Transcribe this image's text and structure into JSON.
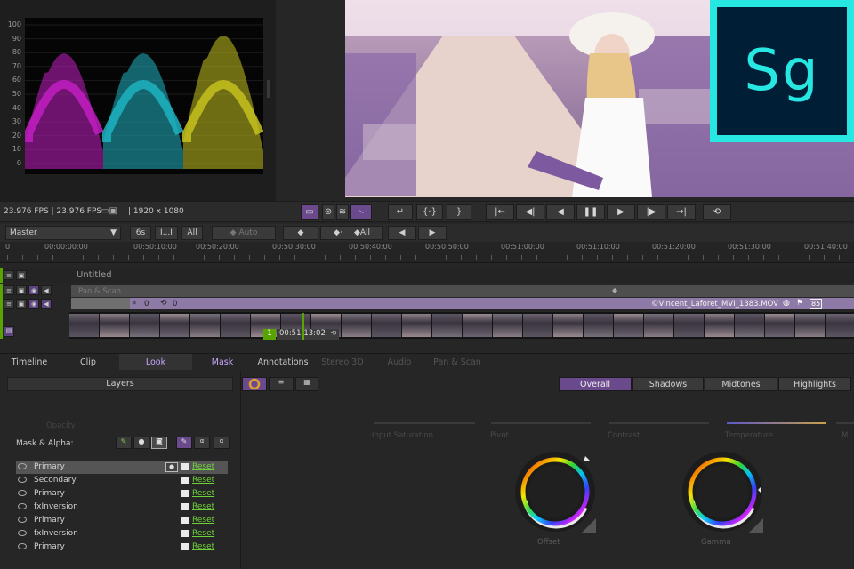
{
  "scope": {
    "ticks": [
      "100",
      "90",
      "80",
      "70",
      "60",
      "50",
      "40",
      "30",
      "20",
      "10",
      "0"
    ],
    "colors": [
      "#c21fc2",
      "#1fb3c2",
      "#c6c21f"
    ]
  },
  "logo": {
    "text": "Sg",
    "bg": "#001e36",
    "accent": "#27e7e3"
  },
  "status": {
    "fps": "23.976 FPS  |  23.976 FPS",
    "resolution": "|  1920 x 1080"
  },
  "toolbar": {
    "master": "Master",
    "duration": "6s",
    "range_one": "I...I",
    "range_all": "All",
    "auto": "Auto",
    "all_btn": "All"
  },
  "ruler": {
    "labels": [
      "0",
      "00:00:00:00",
      "00:50:10:00",
      "00:50:20:00",
      "00:50:30:00",
      "00:50:40:00",
      "00:50:50:00",
      "00:51:00:00",
      "00:51:10:00",
      "00:51:20:00",
      "00:51:30:00",
      "00:51:40:00"
    ]
  },
  "timeline": {
    "track_name": "Untitled",
    "pan_scan": "Pan & Scan",
    "clip_in": "0",
    "clip_start": "0",
    "clip_name": "©Vincent_Laforet_MVI_1383.MOV",
    "clip_badge": "85",
    "marker_num": "1",
    "marker_tc": "00:51:13:02"
  },
  "tabs": [
    "Timeline",
    "Clip",
    "Look",
    "Mask",
    "Annotations",
    "Stereo 3D",
    "Audio",
    "Pan & Scan"
  ],
  "layers": {
    "title": "Layers",
    "opacity": "Opacity",
    "mask_alpha": "Mask & Alpha:",
    "rows": [
      {
        "name": "Primary",
        "reset": "Reset"
      },
      {
        "name": "Secondary",
        "reset": "Reset"
      },
      {
        "name": "Primary",
        "reset": "Reset"
      },
      {
        "name": "fxInversion",
        "reset": "Reset"
      },
      {
        "name": "Primary",
        "reset": "Reset"
      },
      {
        "name": "fxInversion",
        "reset": "Reset"
      },
      {
        "name": "Primary",
        "reset": "Reset"
      }
    ]
  },
  "look": {
    "segments": [
      "Overall",
      "Shadows",
      "Midtones",
      "Highlights"
    ],
    "params": [
      "Input Saturation",
      "Pivot",
      "Contrast",
      "Temperature",
      "M"
    ],
    "wheels": [
      "Offset",
      "Gamma"
    ]
  }
}
